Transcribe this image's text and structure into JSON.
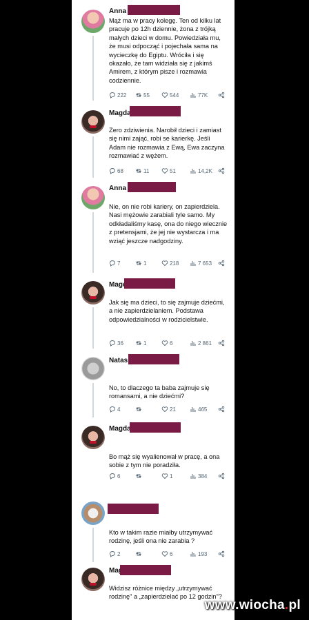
{
  "tweets": [
    {
      "name": "Anna",
      "avatar": "anna-avatar",
      "text": "Mąż ma w pracy kolegę. Ten od kilku lat pracuje po 12h dziennie, żona z trójką małych dzieci w domu. Powiedziała mu, że musi odpocząć i pojechała sama na wycieczkę do Egiptu. Wróciła i się okazało, że tam widziała się z jakimś Amirem, z którym pisze i rozmawia codziennie.",
      "replies": "222",
      "retweets": "55",
      "likes": "544",
      "views": "77K"
    },
    {
      "name": "Magda",
      "avatar": "magda-avatar",
      "text": "Zero zdziwienia. Narobił dzieci i zamiast się nimi zająć, robi se karierkę. Jeśli Adam nie rozmawia z Ewą, Ewa zaczyna rozmawiać z wężem.",
      "replies": "68",
      "retweets": "11",
      "likes": "51",
      "views": "14,2K"
    },
    {
      "name": "Anna",
      "avatar": "anna-avatar",
      "text": "Nie, on nie robi kariery, on zapierdziela. Nasi mężowie zarabiali tyle samo. My odkładaliśmy kasę, ona do niego wiecznie z pretensjami, że jej nie wystarcza i ma wziąć jeszcze nadgodziny.",
      "replies": "7",
      "retweets": "1",
      "likes": "218",
      "views": "7 653"
    },
    {
      "name": "Magd",
      "avatar": "magda-avatar",
      "text": "Jak się ma dzieci, to się zajmuje dziećmi, a nie zapierdzielaniem. Podstawa odpowiedzialności w rodzicielstwie.",
      "replies": "36",
      "retweets": "1",
      "likes": "6",
      "views": "2 861"
    },
    {
      "name": "Natas",
      "avatar": "natas-avatar",
      "text": "No, to dlaczego ta baba zajmuje się romansami, a nie dziećmi?",
      "replies": "4",
      "retweets": "",
      "likes": "21",
      "views": "465"
    },
    {
      "name": "Magda",
      "avatar": "magda-avatar",
      "text": "Bo mąż się wyalienował w pracę, a ona sobie z tym nie poradziła.",
      "replies": "6",
      "retweets": "",
      "likes": "1",
      "views": "384"
    },
    {
      "name": "",
      "avatar": "anon-avatar",
      "text": "Kto w takim razie miałby utrzymywać rodzinę, jeśli ona nie zarabia ?",
      "replies": "2",
      "retweets": "",
      "likes": "6",
      "views": "193"
    },
    {
      "name": "Mag",
      "avatar": "magda-avatar",
      "text": "Widzisz różnice między „utrzymywać rodzinę\" a „zapierdzielać po 12 godzin\"?",
      "replies": "",
      "retweets": "",
      "likes": "",
      "views": ""
    }
  ],
  "watermark": {
    "main": "www.wiocha",
    "dot": ".",
    "tld": "pl"
  },
  "colors": {
    "redaction": "#7a1b45",
    "meta": "#536471",
    "background": "#000000"
  }
}
